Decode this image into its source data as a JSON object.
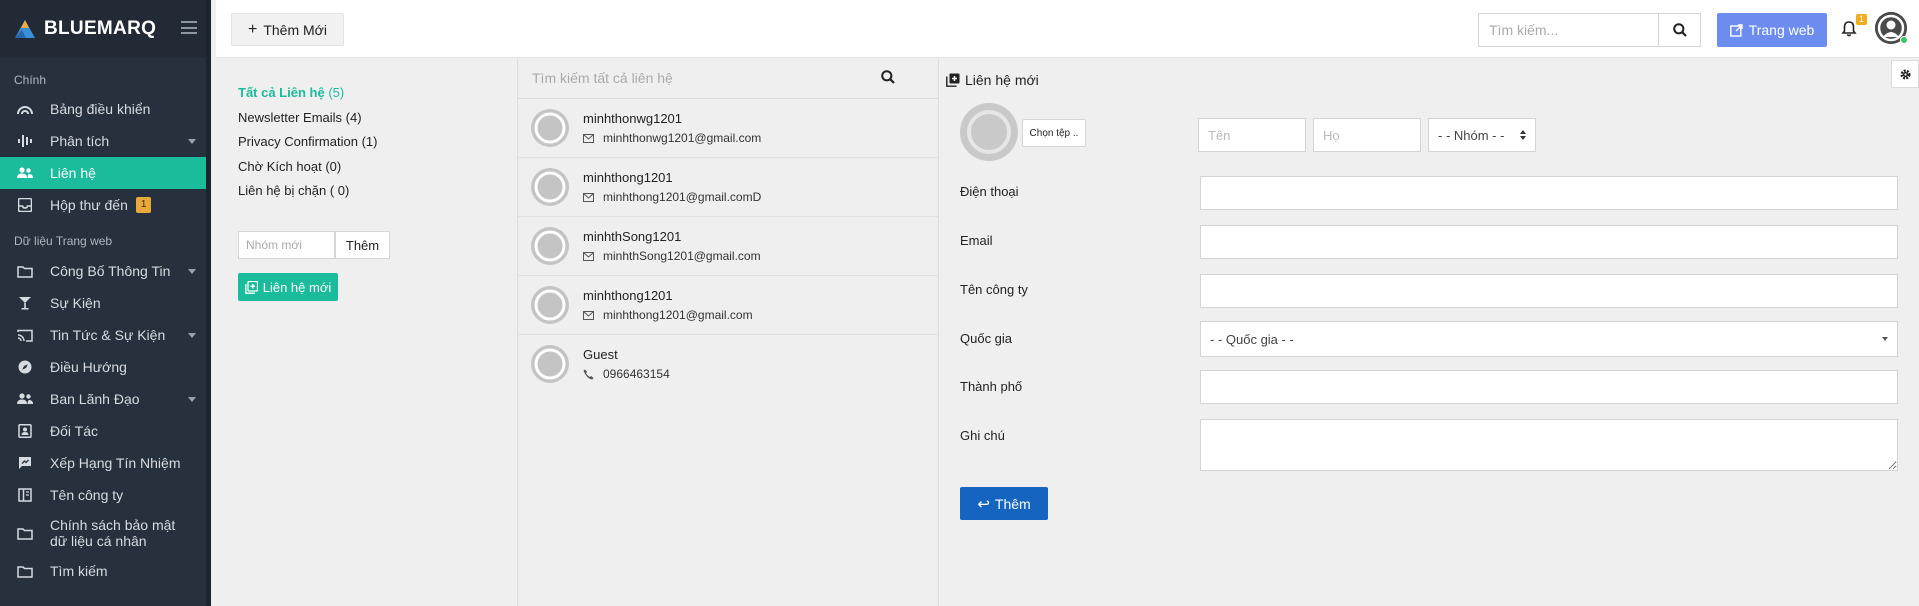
{
  "app": {
    "brand": "BLUEMARQ"
  },
  "colors": {
    "accent": "#1abc9c",
    "sidebar": "#27313d",
    "primary": "#1565c0",
    "web_button": "#6d8cf0"
  },
  "sidebar": {
    "section_main": "Chính",
    "section_web": "Dữ liệu Trang web",
    "items": [
      {
        "label": "Bảng điều khiển",
        "icon": "dashboard-icon"
      },
      {
        "label": "Phân tích",
        "icon": "analytics-icon",
        "caret": true
      },
      {
        "label": "Liên hệ",
        "icon": "contacts-icon",
        "active": true
      },
      {
        "label": "Hộp thư đến",
        "icon": "inbox-icon",
        "badge": "1"
      }
    ],
    "web_items": [
      {
        "label": "Công Bố Thông Tin",
        "icon": "folder-icon",
        "caret": true
      },
      {
        "label": "Sự Kiện",
        "icon": "event-icon"
      },
      {
        "label": "Tin Tức & Sự Kiện",
        "icon": "cast-icon",
        "caret": true
      },
      {
        "label": "Điều Hướng",
        "icon": "compass-icon"
      },
      {
        "label": "Ban Lãnh Đạo",
        "icon": "people-icon",
        "caret": true
      },
      {
        "label": "Đối Tác",
        "icon": "contact-card-icon"
      },
      {
        "label": "Xếp Hạng Tín Nhiệm",
        "icon": "rating-icon"
      },
      {
        "label": "Tên công ty",
        "icon": "company-icon"
      },
      {
        "label": "Chính sách bảo mật dữ liệu cá nhân",
        "icon": "folder-icon"
      },
      {
        "label": "Tìm kiếm",
        "icon": "folder-icon"
      }
    ]
  },
  "topbar": {
    "add_new_label": "Thêm Mới",
    "search_placeholder": "Tìm kiếm...",
    "web_label": "Trang web",
    "notification_count": "1"
  },
  "groups": {
    "items": [
      {
        "name": "Tất cả Liên hệ",
        "count": "(5)",
        "active": true
      },
      {
        "name": "Newsletter Emails",
        "count": "(4)"
      },
      {
        "name": "Privacy Confirmation",
        "count": "(1)"
      },
      {
        "name": "Chờ Kích hoạt",
        "count": "(0)"
      },
      {
        "name": "Liên hệ bị chặn",
        "count": "( 0)"
      }
    ],
    "new_group_placeholder": "Nhóm mới",
    "add_label": "Thêm",
    "new_contact_label": "Liên hệ mới"
  },
  "contacts": {
    "search_placeholder": "Tìm kiếm tất cả liên hệ",
    "list": [
      {
        "name": "minhthonwg1201",
        "detail": "minhthonwg1201@gmail.com",
        "type": "email"
      },
      {
        "name": "minhthong1201",
        "detail": "minhthong1201@gmail.comD",
        "type": "email"
      },
      {
        "name": "minhthSong1201",
        "detail": "minhthSong1201@gmail.com",
        "type": "email"
      },
      {
        "name": "minhthong1201",
        "detail": "minhthong1201@gmail.com",
        "type": "email"
      },
      {
        "name": "Guest",
        "detail": "0966463154",
        "type": "phone"
      }
    ]
  },
  "form": {
    "title": "Liên hệ mới",
    "choose_file": "Chọn tệp ..",
    "first_name_placeholder": "Tên",
    "last_name_placeholder": "Họ",
    "group_select": "- - Nhóm - -",
    "phone_label": "Điện thoại",
    "email_label": "Email",
    "company_label": "Tên công ty",
    "country_label": "Quốc gia",
    "country_select": "- - Quốc gia - -",
    "city_label": "Thành phố",
    "note_label": "Ghi chú",
    "submit_label": "Thêm"
  }
}
